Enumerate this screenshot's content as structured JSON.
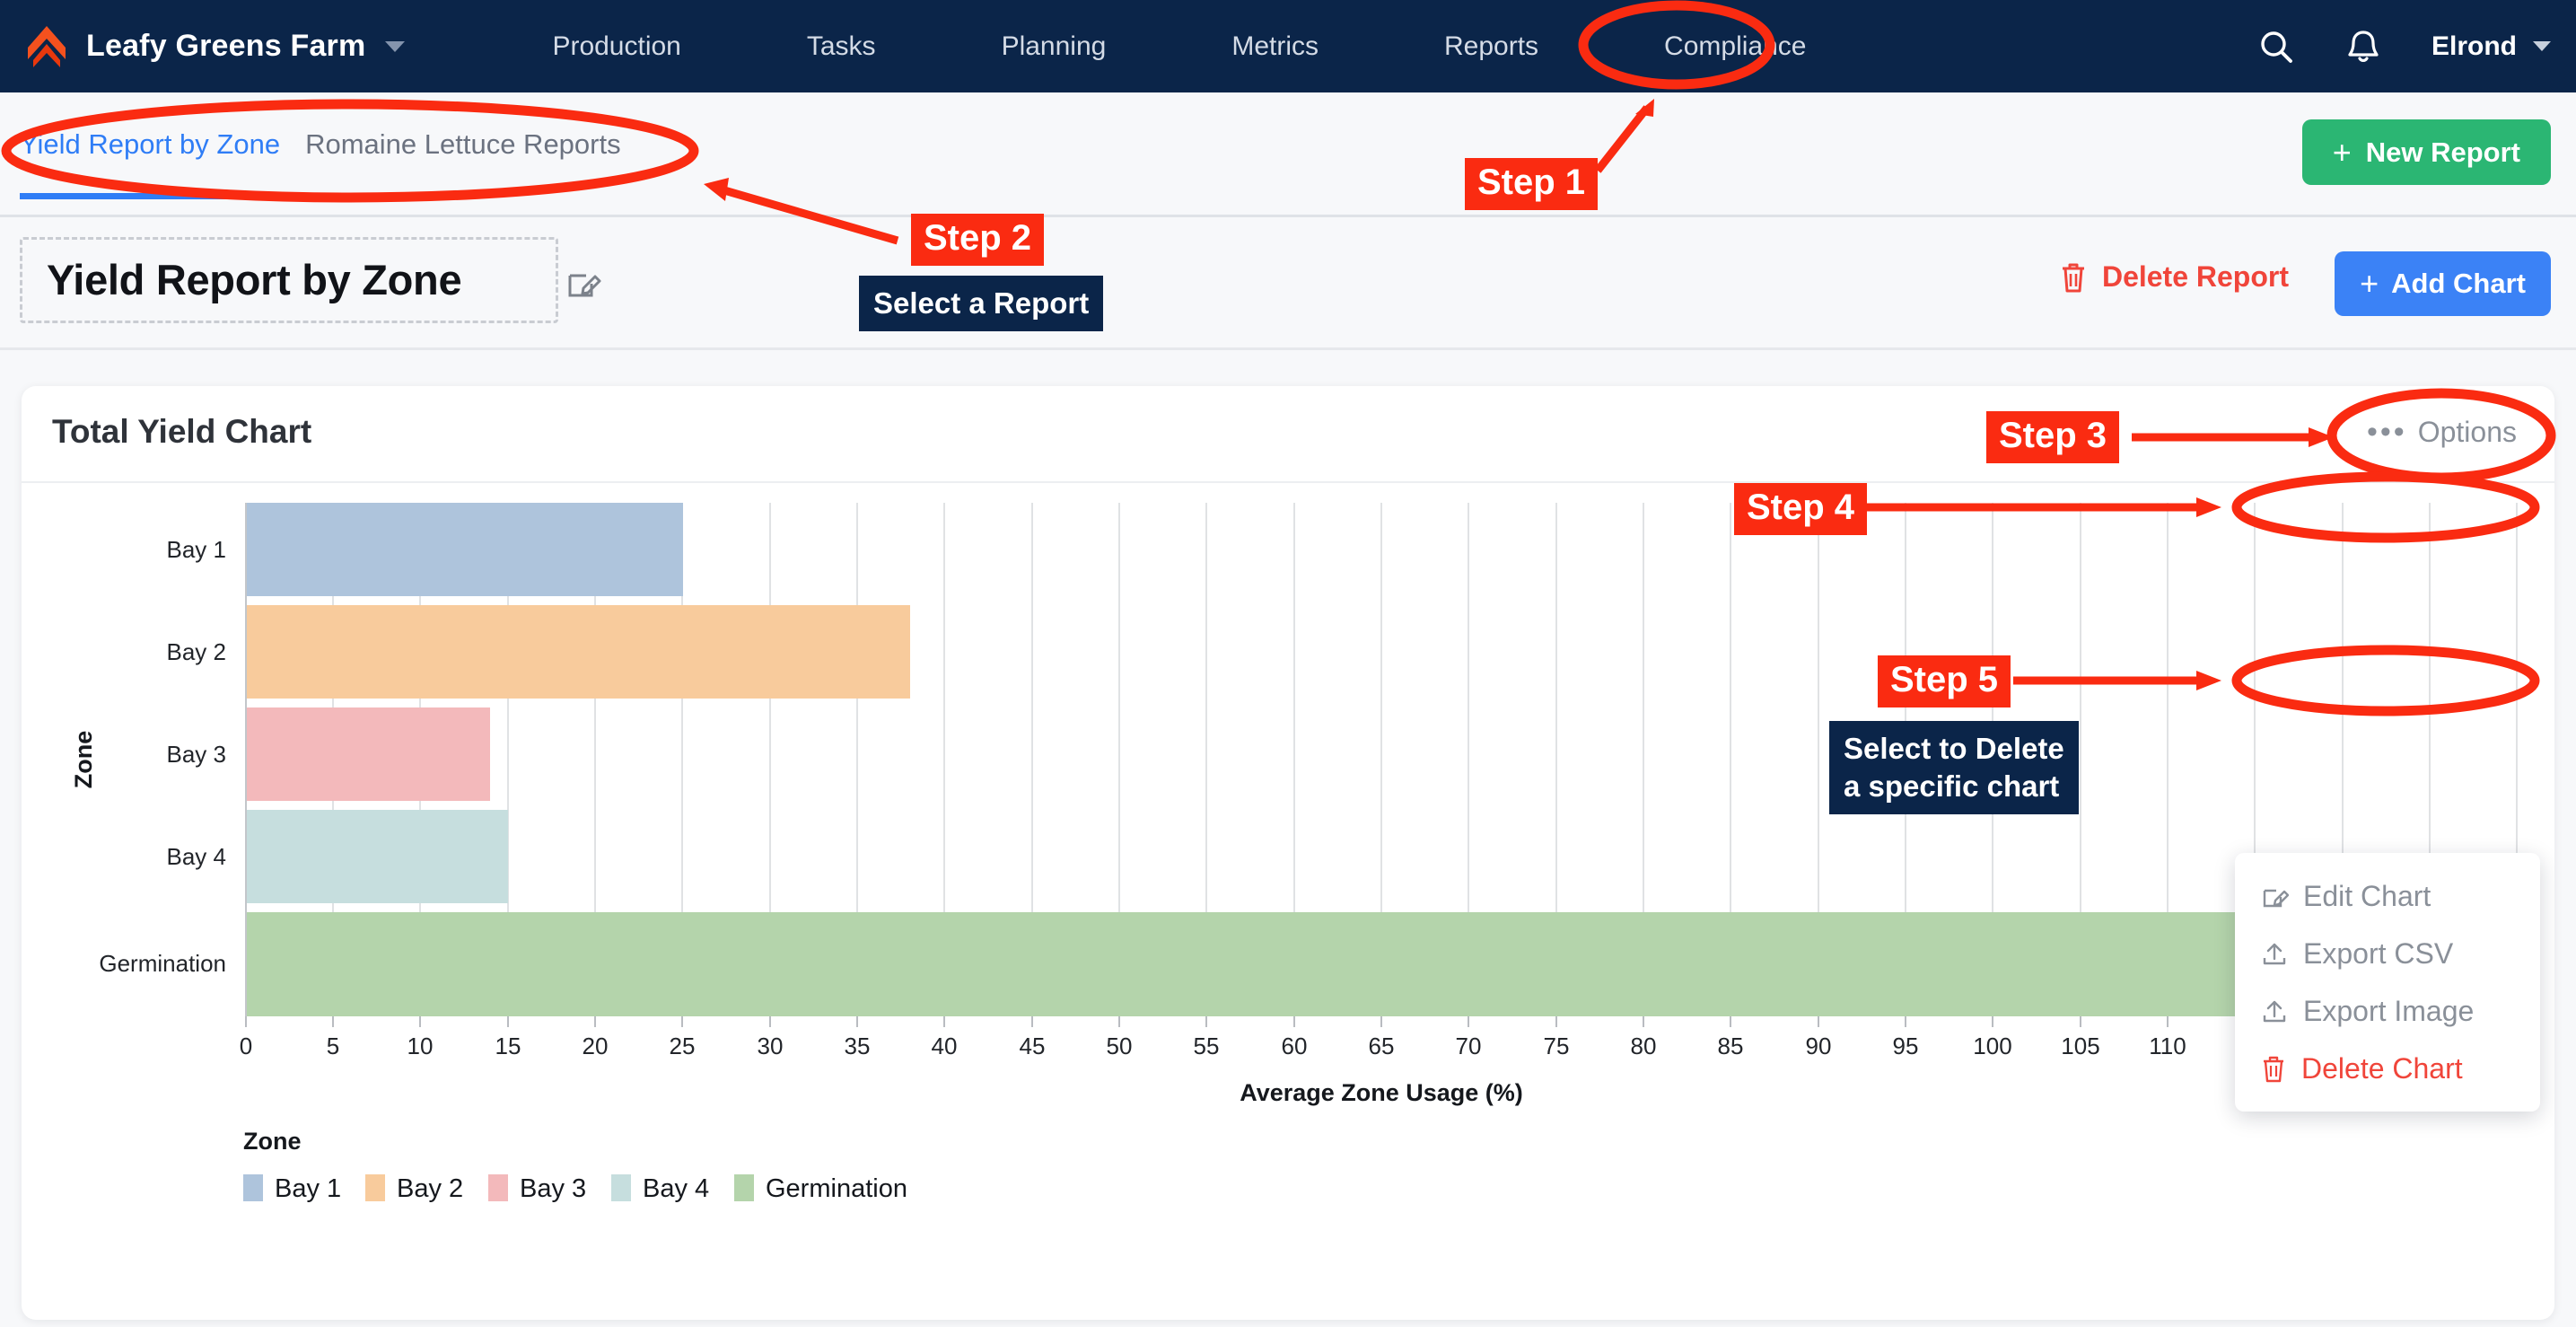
{
  "topnav": {
    "brand": "Leafy Greens Farm",
    "brand_caret_icon": "chevron-down-icon",
    "logo_icon": "leaf-arrow-logo",
    "links": [
      "Production",
      "Tasks",
      "Planning",
      "Metrics",
      "Reports",
      "Compliance"
    ],
    "search_icon": "search-icon",
    "bell_icon": "bell-icon",
    "user": "Elrond",
    "user_caret_icon": "chevron-down-icon",
    "bg_color": "#0b2549"
  },
  "tabbar": {
    "tabs": [
      {
        "label": "Yield Report by Zone",
        "active": true
      },
      {
        "label": "Romaine Lettuce Reports",
        "active": false
      }
    ],
    "new_report_label": "New Report",
    "new_report_plus": "+",
    "new_report_color": "#2bb673"
  },
  "titlerow": {
    "title": "Yield Report by Zone",
    "edit_icon": "pencil-square-icon",
    "delete_report_label": "Delete Report",
    "delete_icon": "trash-icon",
    "delete_color": "#f0453a",
    "add_chart_label": "Add Chart",
    "add_chart_plus": "+",
    "add_chart_color": "#3b82f6"
  },
  "card": {
    "title": "Total Yield Chart",
    "options_label": "Options",
    "options_dots": "•••",
    "menu": [
      {
        "label": "Edit Chart",
        "icon": "pencil-square-icon",
        "danger": false
      },
      {
        "label": "Export CSV",
        "icon": "upload-icon",
        "danger": false
      },
      {
        "label": "Export Image",
        "icon": "upload-icon",
        "danger": false
      },
      {
        "label": "Delete Chart",
        "icon": "trash-icon",
        "danger": true
      }
    ]
  },
  "annotations": [
    {
      "name": "step-1",
      "label": "Step 1"
    },
    {
      "name": "step-2",
      "label": "Step 2"
    },
    {
      "name": "step-2-tip",
      "label": "Select a Report"
    },
    {
      "name": "step-3",
      "label": "Step 3"
    },
    {
      "name": "step-4",
      "label": "Step 4"
    },
    {
      "name": "step-5",
      "label": "Step 5"
    },
    {
      "name": "step-5-tip",
      "label": "Select to Delete\na specific chart"
    }
  ],
  "chart_data": {
    "type": "bar",
    "orientation": "horizontal",
    "title": "Total Yield Chart",
    "categories": [
      "Bay 1",
      "Bay 2",
      "Bay 3",
      "Bay 4",
      "Germination"
    ],
    "values": [
      25,
      38,
      14,
      15,
      128
    ],
    "colors": [
      "#aec4dc",
      "#f8cb9c",
      "#f3b9bb",
      "#c6dede",
      "#b4d4ab"
    ],
    "xlabel": "Average Zone Usage (%)",
    "ylabel": "Zone",
    "xlim": [
      0,
      130
    ],
    "xticks": [
      0,
      5,
      10,
      15,
      20,
      25,
      30,
      35,
      40,
      45,
      50,
      55,
      60,
      65,
      70,
      75,
      80,
      85,
      90,
      95,
      100,
      105,
      110,
      115,
      120,
      125,
      130
    ],
    "grid": true,
    "legend": {
      "title": "Zone",
      "position": "bottom-left",
      "entries": [
        {
          "label": "Bay 1",
          "color": "#aec4dc"
        },
        {
          "label": "Bay 2",
          "color": "#f8cb9c"
        },
        {
          "label": "Bay 3",
          "color": "#f3b9bb"
        },
        {
          "label": "Bay 4",
          "color": "#c6dede"
        },
        {
          "label": "Germination",
          "color": "#b4d4ab"
        }
      ]
    }
  }
}
